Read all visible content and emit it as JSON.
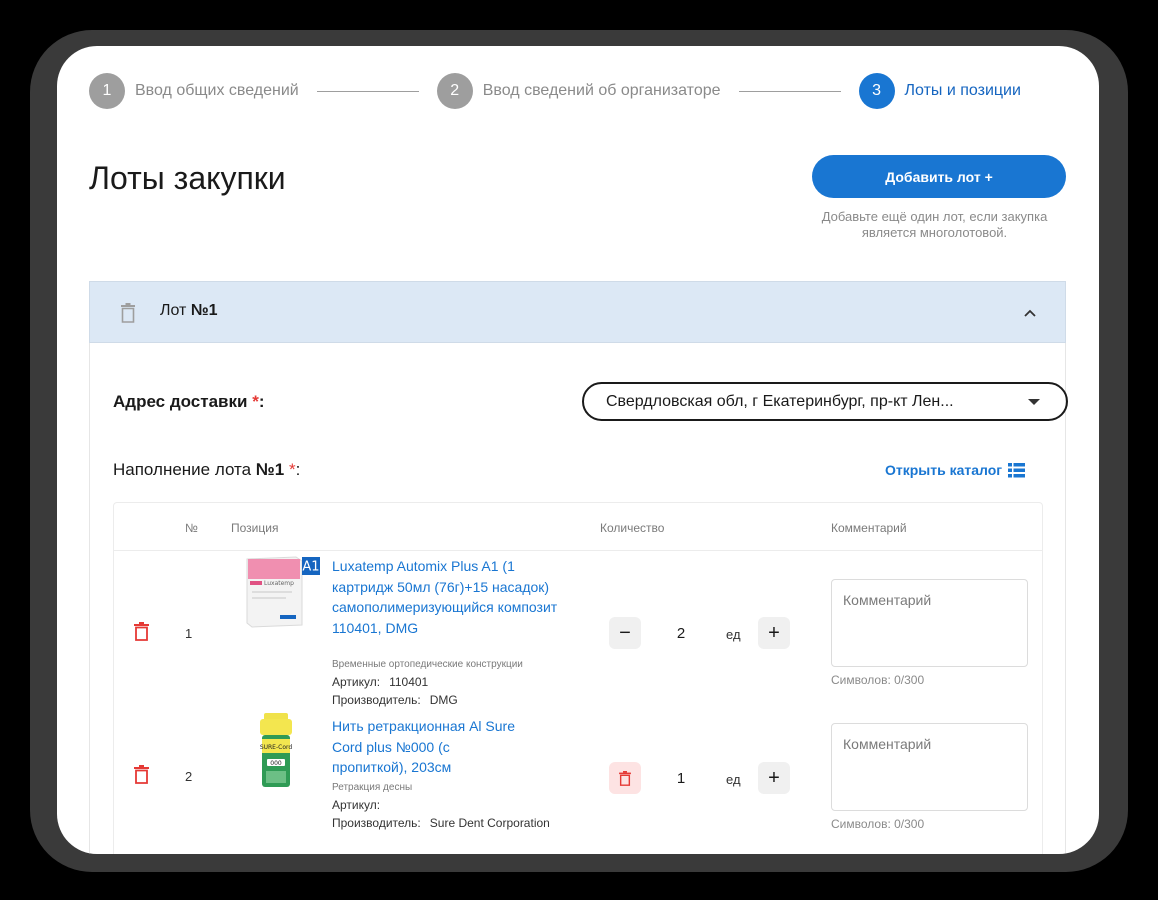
{
  "stepper": {
    "steps": [
      {
        "num": "1",
        "label": "Ввод общих сведений"
      },
      {
        "num": "2",
        "label": "Ввод сведений об организаторе"
      },
      {
        "num": "3",
        "label": "Лоты и позиции"
      }
    ]
  },
  "header": {
    "title": "Лоты закупки",
    "add_lot_label": "Добавить лот +",
    "add_lot_hint": "Добавьте ещё один лот, если закупка является многолотовой."
  },
  "lot": {
    "title_prefix": "Лот",
    "title_number": "№1",
    "address_label": "Адрес доставки",
    "address_value": "Свердловская обл, г Екатеринбург, пр-кт Лен...",
    "required_mark": "*",
    "colon": ":",
    "fill_label_prefix": "Наполнение лота",
    "fill_label_number": "№1",
    "catalog_link": "Открыть каталог"
  },
  "table": {
    "columns": [
      "№",
      "Позиция",
      "Количество",
      "Комментарий"
    ],
    "rows": [
      {
        "num": "1",
        "name": "Luxatemp Automix Plus A1 (1 картридж 50мл (76г)+15 насадок) самополимеризующийся композит 110401, DMG",
        "badge": "A1",
        "category": "Временные ортопедические конструкции",
        "article_label": "Артикул:",
        "article_value": "110401",
        "maker_label": "Производитель:",
        "maker_value": "DMG",
        "qty": "2",
        "unit": "ед",
        "minus": "−",
        "plus": "+",
        "comment_placeholder": "Комментарий",
        "char_count": "Символов: 0/300"
      },
      {
        "num": "2",
        "name": "Нить ретракционная Al Sure Cord plus №000 (с пропиткой), 203см",
        "category": "Ретракция десны",
        "article_label": "Артикул:",
        "article_value": "",
        "maker_label": "Производитель:",
        "maker_value": "Sure Dent Corporation",
        "qty": "1",
        "unit": "ед",
        "plus": "+",
        "comment_placeholder": "Комментарий",
        "char_count": "Символов: 0/300"
      }
    ]
  },
  "colors": {
    "primary": "#1976d2",
    "danger": "#e53935",
    "lot_header_bg": "#dce8f5",
    "step_inactive": "#9e9e9e"
  },
  "images": {
    "product_1_label": "Luxatemp",
    "product_2_label": "SURE-Cord",
    "product_2_code": "000"
  }
}
